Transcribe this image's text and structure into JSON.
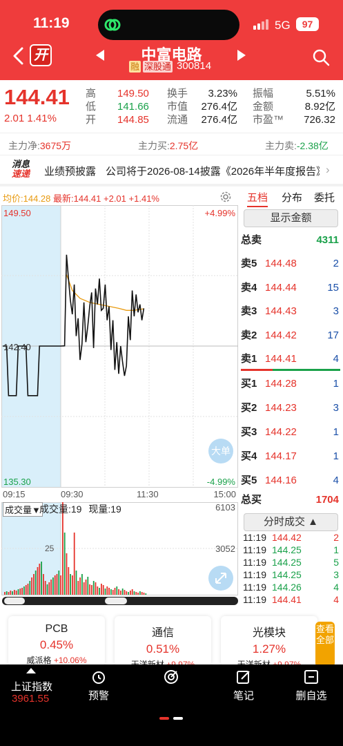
{
  "status": {
    "time": "11:19",
    "network": "5G",
    "battery": "97"
  },
  "header": {
    "open_badge": "开",
    "stock_name": "中富电路",
    "tag_margin": "融",
    "tag_connect": "深股通",
    "stock_code": "300814"
  },
  "quote": {
    "price": "144.41",
    "change": "2.01",
    "change_pct": "1.41%",
    "high_label": "高",
    "high": "149.50",
    "low_label": "低",
    "low": "141.66",
    "open_label": "开",
    "open": "144.85",
    "turnover_label": "换手",
    "turnover": "3.23%",
    "mktcap_label": "市值",
    "mktcap": "276.4亿",
    "float_label": "流通",
    "float": "276.4亿",
    "amplitude_label": "振幅",
    "amplitude": "5.51%",
    "amount_label": "金额",
    "amount": "8.92亿",
    "pe_label": "市盈™",
    "pe": "726.32"
  },
  "flows": {
    "net_label": "主力净:",
    "net": "3675万",
    "buy_label": "主力买:",
    "buy": "2.75亿",
    "sell_label": "主力卖:",
    "sell": "-2.38亿"
  },
  "news": {
    "icon_line1": "消息",
    "icon_line2": "速递",
    "tag": "业绩预披露",
    "text": "公司将于2026-08-14披露《2026年半年度报告》"
  },
  "chart_header": {
    "avg_label": "均价:144.28",
    "latest_label": "最新:144.41",
    "latest_change": "+2.01",
    "latest_pct": "+1.41%"
  },
  "chart_data": {
    "type": "line",
    "price_axis": {
      "top": "149.50",
      "mid": "142.40",
      "bottom": "135.30",
      "top_pct": "+4.99%",
      "bottom_pct": "-4.99%",
      "ylim": [
        135.3,
        149.5
      ]
    },
    "time_ticks": [
      "09:15",
      "09:30",
      "11:30",
      "15:00"
    ],
    "volume_panel": {
      "selector": "成交量▼",
      "vol_label": "成交量:",
      "vol": "19",
      "cur_label": "现量:",
      "cur": "19",
      "top_tick": "6103",
      "mid_tick": "3052",
      "mark": "25"
    },
    "big_order_btn": "大单",
    "series": [
      {
        "name": "price",
        "points": [
          [
            0,
            142.4
          ],
          [
            2,
            142.4
          ],
          [
            3,
            139.9
          ],
          [
            7,
            139.9
          ],
          [
            8,
            142.4
          ],
          [
            12,
            142.4
          ],
          [
            13,
            139.9
          ],
          [
            18,
            139.9
          ],
          [
            19,
            142.4
          ],
          [
            30,
            142.4
          ],
          [
            32,
            142.41
          ],
          [
            33,
            147.0
          ],
          [
            34,
            145.8
          ],
          [
            35,
            144.7
          ],
          [
            36,
            144.0
          ],
          [
            37,
            145.5
          ],
          [
            38,
            142.9
          ],
          [
            39,
            143.8
          ],
          [
            40,
            141.7
          ],
          [
            41,
            142.5
          ],
          [
            42,
            144.6
          ],
          [
            43,
            142.6
          ],
          [
            44,
            143.4
          ],
          [
            45,
            144.4
          ],
          [
            46,
            145.1
          ],
          [
            47,
            142.3
          ],
          [
            48,
            145.3
          ],
          [
            49,
            144.5
          ],
          [
            50,
            145.8
          ],
          [
            51,
            144.2
          ],
          [
            52,
            144.3
          ],
          [
            53,
            145.5
          ],
          [
            54,
            143.7
          ],
          [
            55,
            144.4
          ],
          [
            56,
            142.2
          ],
          [
            57,
            143.7
          ],
          [
            58,
            141.2
          ],
          [
            59,
            142.6
          ],
          [
            60,
            141.0
          ],
          [
            61,
            142.4
          ],
          [
            62,
            141.6
          ],
          [
            63,
            140.9
          ],
          [
            64,
            141.4
          ],
          [
            65,
            143.9
          ],
          [
            66,
            142.7
          ],
          [
            67,
            145.2
          ],
          [
            68,
            143.9
          ],
          [
            69,
            145.0
          ],
          [
            70,
            144.1
          ],
          [
            71,
            144.5
          ],
          [
            72,
            143.7
          ],
          [
            73,
            144.3
          ]
        ]
      },
      {
        "name": "average",
        "points": [
          [
            33,
            146.0
          ],
          [
            36,
            145.2
          ],
          [
            40,
            144.8
          ],
          [
            45,
            144.6
          ],
          [
            50,
            144.5
          ],
          [
            55,
            144.4
          ],
          [
            60,
            144.3
          ],
          [
            64,
            144.2
          ],
          [
            68,
            144.2
          ],
          [
            73,
            144.28
          ]
        ]
      }
    ]
  },
  "orderbook": {
    "tabs": [
      "五档",
      "分布",
      "委托"
    ],
    "show_amount": "显示金额",
    "total_sell_label": "总卖",
    "total_sell": "4311",
    "asks": [
      {
        "label": "卖5",
        "price": "144.48",
        "vol": "2"
      },
      {
        "label": "卖4",
        "price": "144.44",
        "vol": "15"
      },
      {
        "label": "卖3",
        "price": "144.43",
        "vol": "3"
      },
      {
        "label": "卖2",
        "price": "144.42",
        "vol": "17"
      },
      {
        "label": "卖1",
        "price": "144.41",
        "vol": "4"
      }
    ],
    "bids": [
      {
        "label": "买1",
        "price": "144.28",
        "vol": "1"
      },
      {
        "label": "买2",
        "price": "144.23",
        "vol": "3"
      },
      {
        "label": "买3",
        "price": "144.22",
        "vol": "1"
      },
      {
        "label": "买4",
        "price": "144.17",
        "vol": "1"
      },
      {
        "label": "买5",
        "price": "144.16",
        "vol": "4"
      }
    ],
    "total_buy_label": "总买",
    "total_buy": "1704",
    "trades_btn": "分时成交",
    "trades": [
      {
        "time": "11:19",
        "price": "144.42",
        "vol": "2",
        "dir": "up"
      },
      {
        "time": "11:19",
        "price": "144.25",
        "vol": "1",
        "dir": "down"
      },
      {
        "time": "11:19",
        "price": "144.25",
        "vol": "5",
        "dir": "down"
      },
      {
        "time": "11:19",
        "price": "144.25",
        "vol": "3",
        "dir": "down"
      },
      {
        "time": "11:19",
        "price": "144.26",
        "vol": "4",
        "dir": "down"
      },
      {
        "time": "11:19",
        "price": "144.41",
        "vol": "4",
        "dir": "up"
      }
    ]
  },
  "sectors": [
    {
      "name": "PCB",
      "pct": "0.45%",
      "leader": "威派格",
      "leader_pct": "+10.06%"
    },
    {
      "name": "通信",
      "pct": "0.51%",
      "leader": "天洋新材",
      "leader_pct": "+9.97%"
    },
    {
      "name": "光模块",
      "pct": "1.27%",
      "leader": "天洋新材",
      "leader_pct": "+9.97%"
    }
  ],
  "side_tab": "查看全部",
  "bottom_bar": {
    "index_name": "上证指数",
    "index_value": "3961.55",
    "alert": "预警",
    "note": "笔记",
    "remove": "删自选"
  }
}
